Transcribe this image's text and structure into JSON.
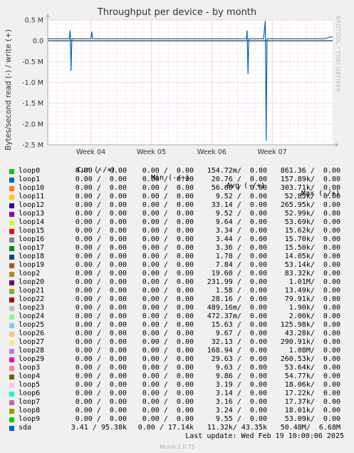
{
  "chart_data": {
    "type": "line",
    "title": "Throughput per device - by month",
    "ylabel": "Bytes/second read (-) / write (+)",
    "y_ticks": [
      "0.5 M",
      "0.0",
      "-0.5 M",
      "-1.0 M",
      "-1.5 M",
      "-2.0 M",
      "-2.5 M"
    ],
    "y_tick_values": [
      0.5,
      0.0,
      -0.5,
      -1.0,
      -1.5,
      -2.0,
      -2.5
    ],
    "ylim": [
      -2.5,
      0.5
    ],
    "x_ticks": [
      "Week 04",
      "Week 05",
      "Week 06",
      "Week 07"
    ],
    "x_tick_days": [
      5,
      12,
      19,
      26
    ],
    "xlim": [
      0,
      33
    ],
    "grid": true,
    "series": [
      {
        "name": "sda",
        "color": "#0066b3",
        "x": [
          0,
          2.5,
          2.6,
          2.7,
          2.8,
          3,
          4,
          5,
          5.1,
          5.2,
          6,
          8,
          9,
          10,
          11,
          12,
          14,
          16,
          18,
          20,
          22,
          23,
          23.1,
          23.2,
          23.3,
          23.4,
          24,
          25,
          25.2,
          25.3,
          25.4,
          25.5,
          26,
          28,
          30,
          31,
          32,
          33
        ],
        "y": [
          0.05,
          0.05,
          0.25,
          -0.72,
          0.05,
          0.05,
          0.05,
          0.05,
          0.22,
          0.05,
          0.05,
          0.05,
          0.05,
          0.05,
          0.05,
          0.05,
          0.05,
          0.05,
          0.05,
          0.05,
          0.05,
          0.05,
          0.25,
          -0.8,
          0.05,
          0.05,
          0.05,
          0.05,
          0.48,
          -2.4,
          0.05,
          0.05,
          0.05,
          0.05,
          0.05,
          0.05,
          0.05,
          0.1
        ]
      }
    ]
  },
  "legend": {
    "headers": {
      "cur": "Cur (-/+)",
      "min": "Min (-/+)",
      "avg": "Avg (-/+)",
      "max": "Max (-/+)"
    },
    "rows": [
      {
        "name": "loop0",
        "color": "#00cc00",
        "cur": "0.00 /  0.00",
        "min": "0.00 /  0.00",
        "avg": "154.72m/  0.00",
        "max": "861.36 /  0.00"
      },
      {
        "name": "loop1",
        "color": "#0066b3",
        "cur": "0.00 /  0.00",
        "min": "0.00 /  0.00",
        "avg": "20.76 /  0.00",
        "max": "157.89k/  0.00"
      },
      {
        "name": "loop10",
        "color": "#ff8000",
        "cur": "0.00 /  0.00",
        "min": "0.00 /  0.00",
        "avg": "56.60 /  0.00",
        "max": "303.71k/  0.00"
      },
      {
        "name": "loop11",
        "color": "#ffcc00",
        "cur": "0.00 /  0.00",
        "min": "0.00 /  0.00",
        "avg": "9.52 /  0.00",
        "max": "52.85k/  0.00"
      },
      {
        "name": "loop12",
        "color": "#330099",
        "cur": "0.00 /  0.00",
        "min": "0.00 /  0.00",
        "avg": "33.14 /  0.00",
        "max": "265.95k/  0.00"
      },
      {
        "name": "loop13",
        "color": "#990099",
        "cur": "0.00 /  0.00",
        "min": "0.00 /  0.00",
        "avg": "9.52 /  0.00",
        "max": "52.99k/  0.00"
      },
      {
        "name": "loop14",
        "color": "#ccff00",
        "cur": "0.00 /  0.00",
        "min": "0.00 /  0.00",
        "avg": "9.64 /  0.00",
        "max": "53.69k/  0.00"
      },
      {
        "name": "loop15",
        "color": "#ff0000",
        "cur": "0.00 /  0.00",
        "min": "0.00 /  0.00",
        "avg": "3.34 /  0.00",
        "max": "15.62k/  0.00"
      },
      {
        "name": "loop16",
        "color": "#808080",
        "cur": "0.00 /  0.00",
        "min": "0.00 /  0.00",
        "avg": "3.44 /  0.00",
        "max": "15.70k/  0.00"
      },
      {
        "name": "loop17",
        "color": "#008f00",
        "cur": "0.00 /  0.00",
        "min": "0.00 /  0.00",
        "avg": "3.36 /  0.00",
        "max": "15.50k/  0.00"
      },
      {
        "name": "loop18",
        "color": "#00487d",
        "cur": "0.00 /  0.00",
        "min": "0.00 /  0.00",
        "avg": "1.78 /  0.00",
        "max": "14.05k/  0.00"
      },
      {
        "name": "loop19",
        "color": "#b35a00",
        "cur": "0.00 /  0.00",
        "min": "0.00 /  0.00",
        "avg": "7.84 /  0.00",
        "max": "53.14k/  0.00"
      },
      {
        "name": "loop2",
        "color": "#b38f00",
        "cur": "0.00 /  0.00",
        "min": "0.00 /  0.00",
        "avg": "19.60 /  0.00",
        "max": "83.32k/  0.00"
      },
      {
        "name": "loop20",
        "color": "#6b006b",
        "cur": "0.00 /  0.00",
        "min": "0.00 /  0.00",
        "avg": "231.99 /  0.00",
        "max": "1.01M/  0.00"
      },
      {
        "name": "loop21",
        "color": "#8fb300",
        "cur": "0.00 /  0.00",
        "min": "0.00 /  0.00",
        "avg": "1.58 /  0.00",
        "max": "13.49k/  0.00"
      },
      {
        "name": "loop22",
        "color": "#b30000",
        "cur": "0.00 /  0.00",
        "min": "0.00 /  0.00",
        "avg": "28.16 /  0.00",
        "max": "79.91k/  0.00"
      },
      {
        "name": "loop23",
        "color": "#bebebe",
        "cur": "0.00 /  0.00",
        "min": "0.00 /  0.00",
        "avg": "489.16m/  0.00",
        "max": "1.90k/  0.00"
      },
      {
        "name": "loop24",
        "color": "#80ff80",
        "cur": "0.00 /  0.00",
        "min": "0.00 /  0.00",
        "avg": "472.37m/  0.00",
        "max": "2.00k/  0.00"
      },
      {
        "name": "loop25",
        "color": "#80c9ff",
        "cur": "0.00 /  0.00",
        "min": "0.00 /  0.00",
        "avg": "15.63 /  0.00",
        "max": "125.98k/  0.00"
      },
      {
        "name": "loop26",
        "color": "#ffc080",
        "cur": "0.00 /  0.00",
        "min": "0.00 /  0.00",
        "avg": "9.67 /  0.00",
        "max": "43.28k/  0.00"
      },
      {
        "name": "loop27",
        "color": "#ffe680",
        "cur": "0.00 /  0.00",
        "min": "0.00 /  0.00",
        "avg": "32.13 /  0.00",
        "max": "290.91k/  0.00"
      },
      {
        "name": "loop28",
        "color": "#aa80ff",
        "cur": "0.00 /  0.00",
        "min": "0.00 /  0.00",
        "avg": "168.94 /  0.00",
        "max": "1.08M/  0.00"
      },
      {
        "name": "loop29",
        "color": "#ee00cc",
        "cur": "0.00 /  0.00",
        "min": "0.00 /  0.00",
        "avg": "29.63 /  0.00",
        "max": "260.53k/  0.00"
      },
      {
        "name": "loop3",
        "color": "#ff8080",
        "cur": "0.00 /  0.00",
        "min": "0.00 /  0.00",
        "avg": "9.63 /  0.00",
        "max": "53.64k/  0.00"
      },
      {
        "name": "loop4",
        "color": "#666600",
        "cur": "0.00 /  0.00",
        "min": "0.00 /  0.00",
        "avg": "9.86 /  0.00",
        "max": "54.77k/  0.00"
      },
      {
        "name": "loop5",
        "color": "#ffbfff",
        "cur": "0.00 /  0.00",
        "min": "0.00 /  0.00",
        "avg": "3.19 /  0.00",
        "max": "18.06k/  0.00"
      },
      {
        "name": "loop6",
        "color": "#00ffcc",
        "cur": "0.00 /  0.00",
        "min": "0.00 /  0.00",
        "avg": "3.14 /  0.00",
        "max": "17.22k/  0.00"
      },
      {
        "name": "loop7",
        "color": "#cc6699",
        "cur": "0.00 /  0.00",
        "min": "0.00 /  0.00",
        "avg": "3.16 /  0.00",
        "max": "17.37k/  0.00"
      },
      {
        "name": "loop8",
        "color": "#999900",
        "cur": "0.00 /  0.00",
        "min": "0.00 /  0.00",
        "avg": "3.24 /  0.00",
        "max": "18.01k/  0.00"
      },
      {
        "name": "loop9",
        "color": "#00cc00",
        "cur": "0.00 /  0.00",
        "min": "0.00 /  0.00",
        "avg": "9.55 /  0.00",
        "max": "53.09k/  0.00"
      },
      {
        "name": "sda",
        "color": "#0066b3",
        "cur": "3.41 / 95.38k",
        "min": "0.00 / 17.14k",
        "avg": "11.32k/ 43.35k",
        "max": "50.48M/  6.68M"
      }
    ]
  },
  "footer": {
    "last_update": "Last update: Wed Feb 19 10:00:06 2025",
    "version": "Munin 2.0.75"
  },
  "watermark": "RRDTOOL / TOBI OETIKER"
}
